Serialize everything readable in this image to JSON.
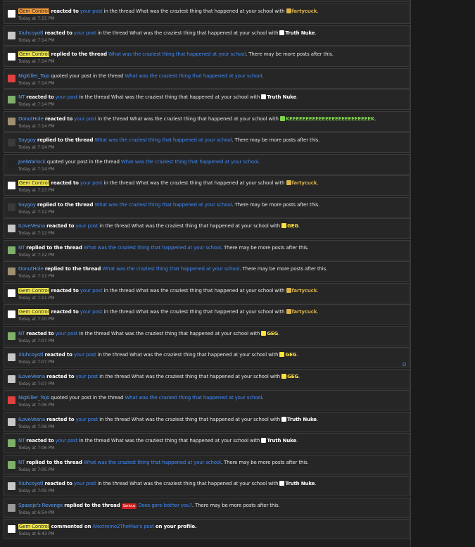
{
  "thread": "What was the craziest thing that happened at your school",
  "reactions": {
    "fartycuck": {
      "label": "fartycuck",
      "color": "#d8b04a"
    },
    "truth_nuke": {
      "label": "Truth Nuke",
      "color": "#ffffff"
    },
    "geg": {
      "label": "GEG",
      "color": "#ffe23a"
    },
    "keek": {
      "label": "KEEEEEEEEEEEEEEEEEEEEEEEEEK",
      "color": "#7fd34a"
    }
  },
  "alerts": [
    {
      "user": "Gem Control",
      "ustyle": "gem-o",
      "avatar": "#ffffff",
      "type": "reacted",
      "reaction": "fartycuck",
      "time": "Today at 7:15 PM"
    },
    {
      "user": "Xiuhcoyotl",
      "ustyle": "",
      "avatar": "#c8c8c8",
      "type": "reacted",
      "reaction": "truth_nuke",
      "time": "Today at 7:14 PM"
    },
    {
      "user": "Gem Control",
      "ustyle": "gem",
      "avatar": "#ffffff",
      "type": "replied",
      "time": "Today at 7:14 PM"
    },
    {
      "user": "NigKiller_Tojo",
      "ustyle": "",
      "avatar": "#e04040",
      "type": "quoted",
      "time": "Today at 7:14 PM"
    },
    {
      "user": "NT",
      "ustyle": "",
      "avatar": "#7fb06a",
      "type": "reacted",
      "reaction": "truth_nuke",
      "time": "Today at 7:14 PM"
    },
    {
      "user": "DonutHole",
      "ustyle": "",
      "avatar": "#a09070",
      "type": "reacted",
      "reaction": "keek",
      "time": "Today at 7:14 PM"
    },
    {
      "user": "Soygoy",
      "ustyle": "soy",
      "avatar": "#3a3a3a",
      "type": "replied",
      "time": "Today at 7:14 PM"
    },
    {
      "user": "JoelWarlock",
      "ustyle": "",
      "avatar": "#222222",
      "type": "quoted",
      "time": "Today at 7:14 PM"
    },
    {
      "user": "Gem Control",
      "ustyle": "gem",
      "avatar": "#ffffff",
      "type": "reacted",
      "reaction": "fartycuck",
      "time": "Today at 7:13 PM"
    },
    {
      "user": "Soygoy",
      "ustyle": "soy",
      "avatar": "#3a3a3a",
      "type": "replied",
      "time": "Today at 7:12 PM"
    },
    {
      "user": "ILoveVesna",
      "ustyle": "",
      "avatar": "#c8c8c8",
      "type": "reacted",
      "reaction": "geg",
      "time": "Today at 7:12 PM"
    },
    {
      "user": "NT",
      "ustyle": "",
      "avatar": "#7fb06a",
      "type": "replied",
      "time": "Today at 7:12 PM"
    },
    {
      "user": "DonutHole",
      "ustyle": "",
      "avatar": "#a09070",
      "type": "replied",
      "time": "Today at 7:11 PM"
    },
    {
      "user": "Gem Control",
      "ustyle": "gem",
      "avatar": "#ffffff",
      "type": "reacted",
      "reaction": "fartycuck",
      "time": "Today at 7:11 PM"
    },
    {
      "user": "Gem Control",
      "ustyle": "gem",
      "avatar": "#ffffff",
      "type": "reacted",
      "reaction": "fartycuck",
      "time": "Today at 7:10 PM"
    },
    {
      "user": "NT",
      "ustyle": "",
      "avatar": "#7fb06a",
      "type": "reacted",
      "reaction": "geg",
      "time": "Today at 7:07 PM"
    },
    {
      "user": "Xiuhcoyotl",
      "ustyle": "",
      "avatar": "#c8c8c8",
      "type": "reacted",
      "reaction": "geg",
      "time": "Today at 7:07 PM"
    },
    {
      "user": "ILoveVesna",
      "ustyle": "",
      "avatar": "#c8c8c8",
      "type": "reacted",
      "reaction": "geg",
      "time": "Today at 7:07 PM"
    },
    {
      "user": "NigKiller_Tojo",
      "ustyle": "",
      "avatar": "#e04040",
      "type": "quoted",
      "time": "Today at 7:06 PM"
    },
    {
      "user": "ILoveVesna",
      "ustyle": "",
      "avatar": "#c8c8c8",
      "type": "reacted",
      "reaction": "truth_nuke",
      "time": "Today at 7:06 PM"
    },
    {
      "user": "NT",
      "ustyle": "",
      "avatar": "#7fb06a",
      "type": "reacted",
      "reaction": "truth_nuke",
      "time": "Today at 7:06 PM"
    },
    {
      "user": "NT",
      "ustyle": "",
      "avatar": "#7fb06a",
      "type": "replied",
      "time": "Today at 7:05 PM"
    },
    {
      "user": "Xiuhcoyotl",
      "ustyle": "",
      "avatar": "#c8c8c8",
      "type": "reacted",
      "reaction": "truth_nuke",
      "time": "Today at 7:05 PM"
    },
    {
      "user": "Spasoje's Revenge",
      "ustyle": "",
      "avatar": "#9a9a9a",
      "type": "replied_tag",
      "tag": "Serious",
      "other_thread": "Does gore bother you?",
      "time": "Today at 6:54 PM"
    },
    {
      "user": "Gem Control",
      "ustyle": "gem",
      "avatar": "#ffffff",
      "type": "commented",
      "target": "Alextremo2TheMax's post",
      "time": "Today at 6:43 PM"
    }
  ],
  "strings": {
    "reacted_to": "reacted to",
    "your_post": "your post",
    "in_the_thread": "in the thread",
    "at_your_school_with": "with",
    "replied_to_the_thread": "replied to the thread",
    "more_posts": ". There may be more posts after this.",
    "quoted_your_post": "quoted your post in the thread",
    "commented_on": "commented on",
    "on_your_profile": "on your profile.",
    "scroll_mark": "D"
  }
}
